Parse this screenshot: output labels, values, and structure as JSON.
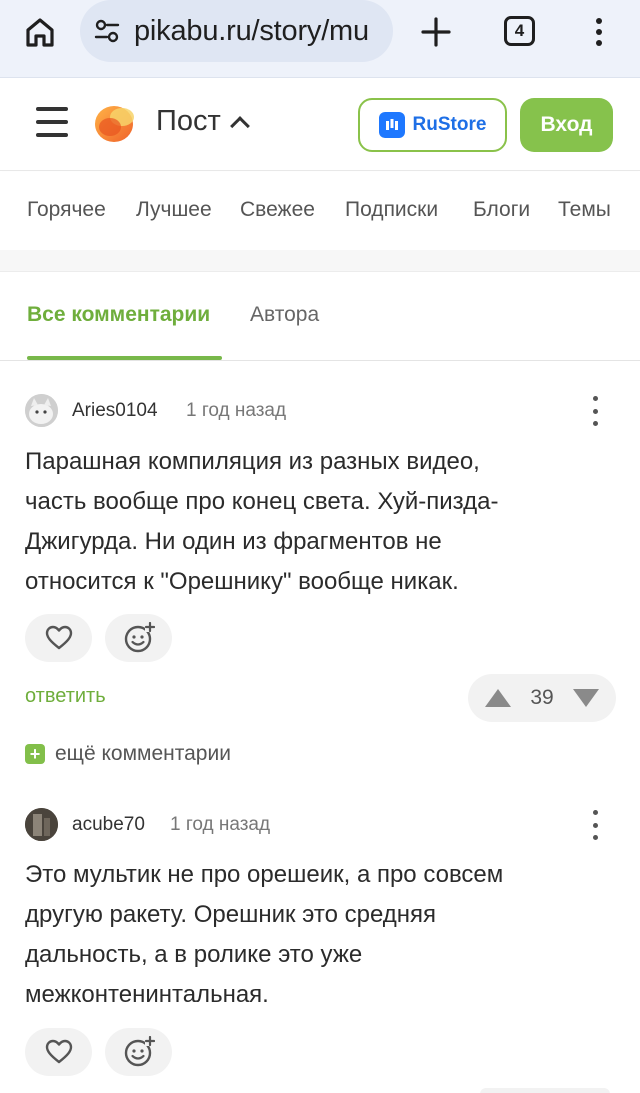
{
  "browser": {
    "url": "pikabu.ru/story/mu",
    "tab_count": "4"
  },
  "header": {
    "title": "Пост",
    "rustore_label": "RuStore",
    "login_label": "Вход"
  },
  "nav": {
    "items": [
      "Горячее",
      "Лучшее",
      "Свежее",
      "Подписки",
      "Блоги",
      "Темы"
    ]
  },
  "comment_tabs": {
    "all": "Все комментарии",
    "author": "Автора"
  },
  "comments": [
    {
      "author": "Aries0104",
      "time": "1 год назад",
      "lines": [
        "Парашная компиляция из разных видео,",
        "часть вообще про конец света. Хуй-пизда-",
        "Джигурда. Ни один из фрагментов не",
        "относится к \"Орешнику\" вообще никак."
      ],
      "reply_label": "ответить",
      "rating": "39",
      "more_label": "ещё комментарии"
    },
    {
      "author": "acube70",
      "time": "1 год назад",
      "lines": [
        "Это мультик не про орешеик, а про совсем",
        "другую ракету. Орешник это средняя",
        "дальность, а в ролике это уже",
        "межконтенинтальная."
      ]
    }
  ],
  "colors": {
    "accent_green": "#6fae3c",
    "button_green": "#86c24c",
    "rustore_blue": "#1e78ff"
  },
  "icons": [
    "home-icon",
    "site-settings-icon",
    "plus-icon",
    "tabs-icon",
    "menu-icon",
    "burger-icon",
    "pikabu-logo",
    "caret-up-icon",
    "rustore-icon",
    "kebab-icon",
    "heart-icon",
    "emoji-add-icon",
    "arrow-up-icon",
    "arrow-down-icon",
    "plus-square-icon"
  ]
}
